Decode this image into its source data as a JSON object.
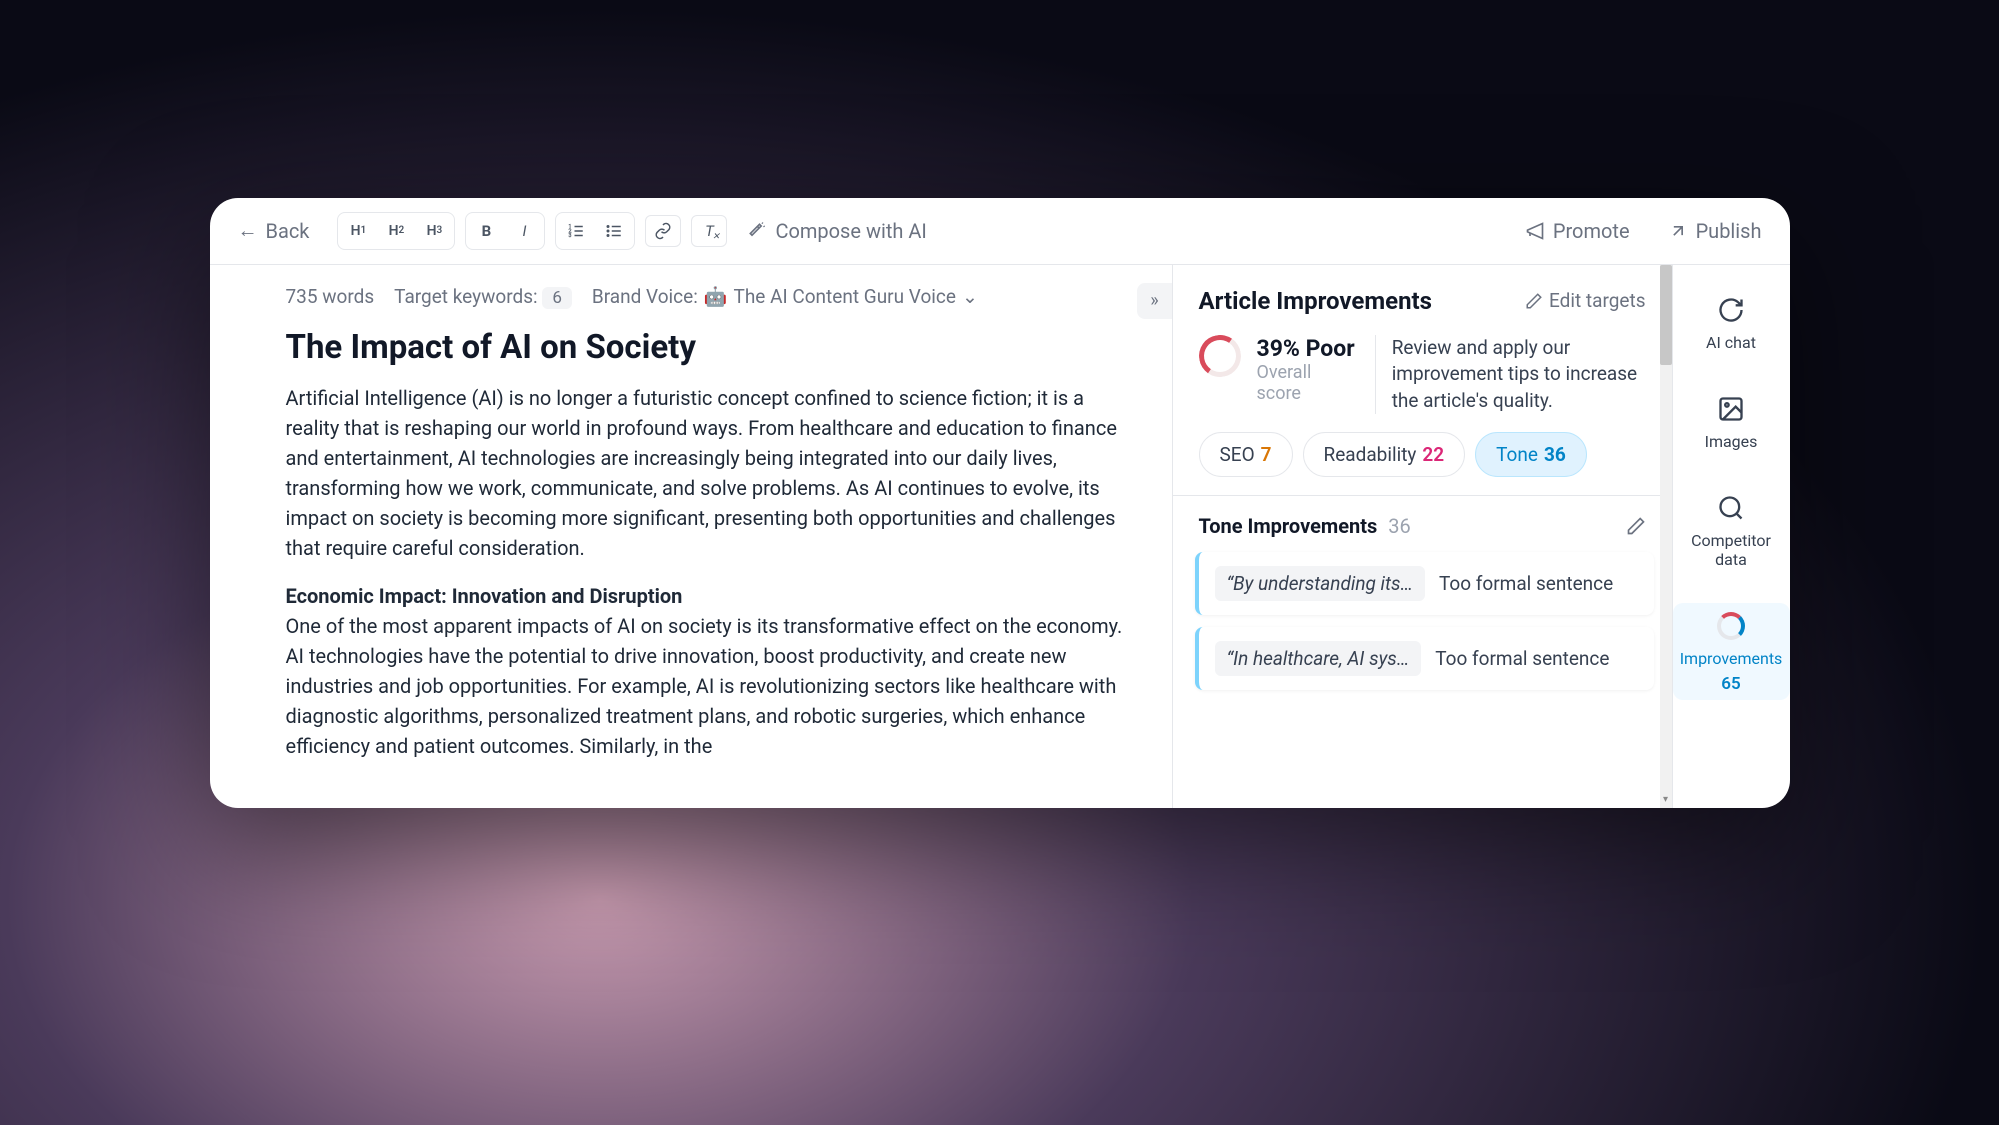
{
  "toolbar": {
    "back_label": "Back",
    "compose_label": "Compose with AI",
    "promote_label": "Promote",
    "publish_label": "Publish"
  },
  "meta": {
    "word_count": "735 words",
    "target_keywords_label": "Target keywords:",
    "target_keywords_count": "6",
    "brand_voice_label": "Brand Voice:",
    "brand_voice_value": "The AI Content Guru Voice"
  },
  "article": {
    "title": "The Impact of AI on Society",
    "p1": "Artificial Intelligence (AI) is no longer a futuristic concept confined to science fiction; it is a reality that is reshaping our world in profound ways. From healthcare and education to finance and entertainment, AI technologies are increasingly being integrated into our daily lives, transforming how we work, communicate, and solve problems. As AI continues to evolve, its impact on society is becoming more significant, presenting both opportunities and challenges that require careful consideration.",
    "h2": "Economic Impact: Innovation and Disruption",
    "p2": "One of the most apparent impacts of AI on society is its transformative effect on the economy. AI technologies have the potential to drive innovation, boost productivity, and create new industries and job opportunities. For example, AI is revolutionizing sectors like healthcare with diagnostic algorithms, personalized treatment plans, and robotic surgeries, which enhance efficiency and patient outcomes. Similarly, in the"
  },
  "panel": {
    "title": "Article Improvements",
    "edit_targets_label": "Edit targets",
    "score_percent": "39% Poor",
    "score_sub": "Overall score",
    "score_desc": "Review and apply our improvement tips to increase the article's quality.",
    "pills": {
      "seo_label": "SEO",
      "seo_count": "7",
      "read_label": "Readability",
      "read_count": "22",
      "tone_label": "Tone",
      "tone_count": "36"
    },
    "section_title": "Tone Improvements",
    "section_count": "36",
    "items": [
      {
        "quote": "“By understanding its…",
        "reason": "Too formal sentence"
      },
      {
        "quote": "“In healthcare, AI sys…",
        "reason": "Too formal sentence"
      }
    ]
  },
  "rail": {
    "ai_chat": "AI chat",
    "images": "Images",
    "competitor": "Competitor data",
    "improvements": "Improvements",
    "improvements_count": "65"
  }
}
